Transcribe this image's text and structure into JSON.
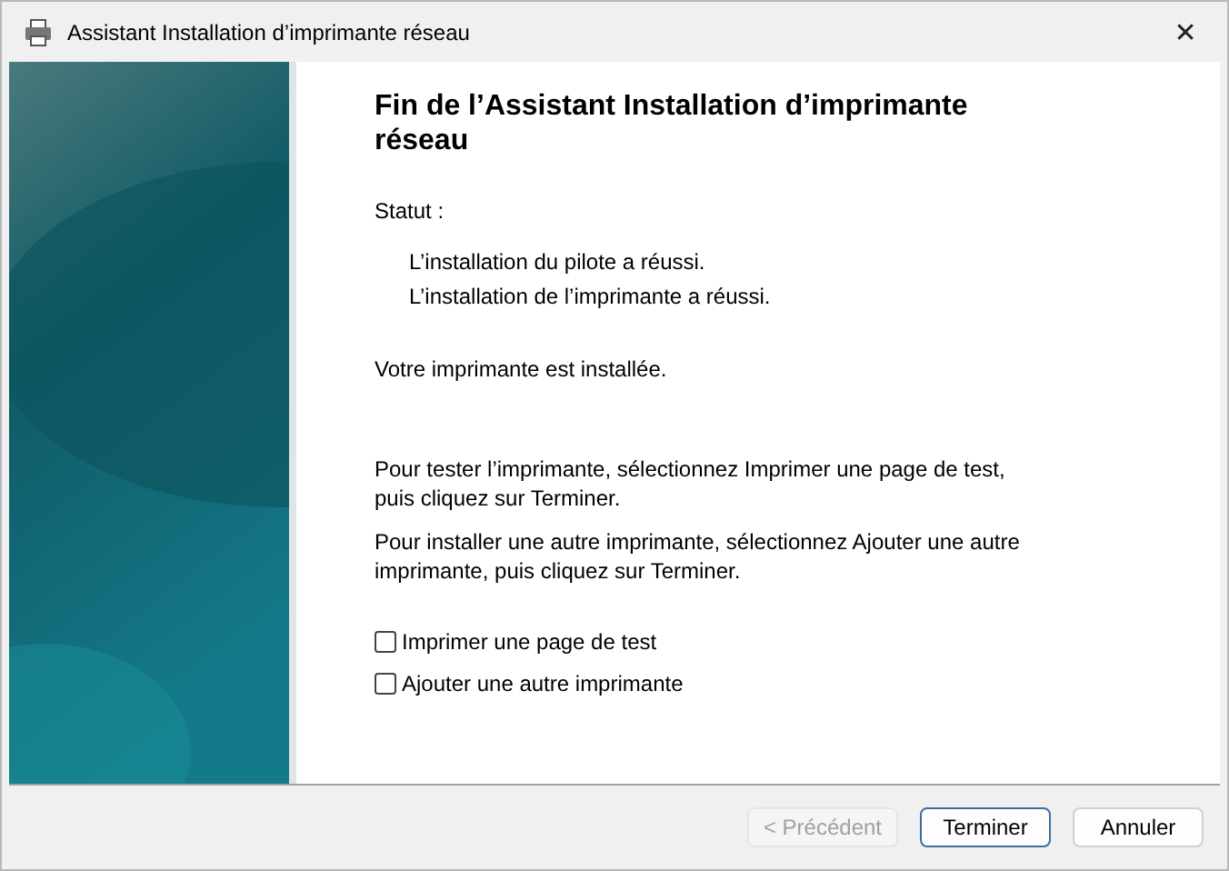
{
  "window": {
    "title": "Assistant Installation d’imprimante réseau",
    "close": "✕"
  },
  "heading": "Fin de l’Assistant Installation d’imprimante réseau",
  "status_label": "Statut :",
  "status_lines": [
    "L’installation du pilote a réussi.",
    "L’installation de l’imprimante a réussi."
  ],
  "result": "Votre imprimante est installée.",
  "instructions": [
    "Pour tester l’imprimante, sélectionnez Imprimer une page de test, puis cliquez sur Terminer.",
    "Pour installer une autre imprimante, sélectionnez Ajouter une autre imprimante, puis cliquez sur Terminer."
  ],
  "options": [
    {
      "label": "Imprimer une page de test",
      "checked": false
    },
    {
      "label": "Ajouter une autre imprimante",
      "checked": false
    }
  ],
  "buttons": [
    {
      "label": "< Précédent",
      "disabled": true,
      "default": false
    },
    {
      "label": "Terminer",
      "disabled": false,
      "default": true
    },
    {
      "label": "Annuler",
      "disabled": false,
      "default": false
    }
  ]
}
